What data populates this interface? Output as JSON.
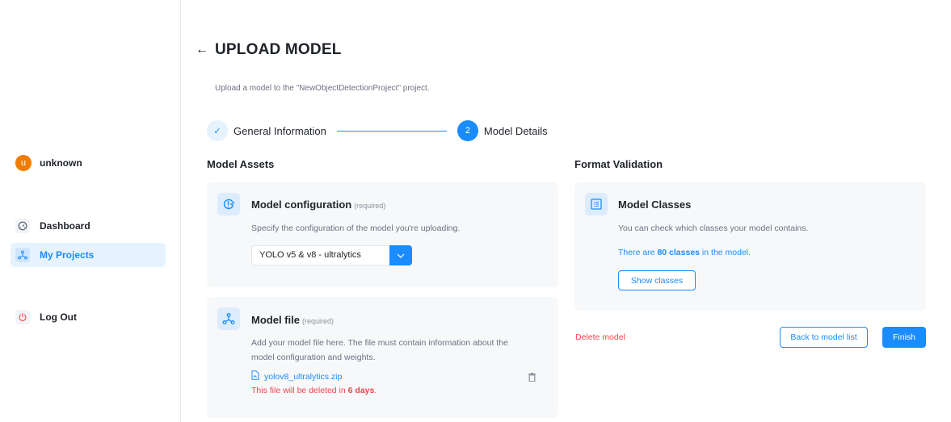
{
  "user": {
    "initial": "u",
    "name": "unknown",
    "avatar_color": "#f07c00"
  },
  "sidebar": {
    "items": [
      {
        "label": "Dashboard",
        "icon": "gauge-icon",
        "active": false
      },
      {
        "label": "My Projects",
        "icon": "network-icon",
        "active": true
      },
      {
        "label": "Log Out",
        "icon": "power-icon",
        "active": false
      }
    ]
  },
  "header": {
    "back_icon": "←",
    "title": "UPLOAD MODEL",
    "subtitle": "Upload a model to the \"NewObjectDetectionProject\" project."
  },
  "stepper": {
    "steps": [
      {
        "label": "General Information",
        "marker": "✓",
        "state": "done"
      },
      {
        "label": "Model Details",
        "marker": "2",
        "state": "current"
      }
    ]
  },
  "assets": {
    "section_title": "Model Assets",
    "config": {
      "title": "Model configuration",
      "required": "(required)",
      "description": "Specify the configuration of the model you're uploading.",
      "selected": "YOLO v5 & v8 - ultralytics"
    },
    "file": {
      "title": "Model file",
      "required": "(required)",
      "description": "Add your model file here. The file must contain information about the model configuration and weights.",
      "filename": "yolov8_ultralytics.zip",
      "warning_prefix": "This file will be deleted in ",
      "warning_days": "6 days",
      "warning_suffix": "."
    }
  },
  "validation": {
    "section_title": "Format Validation",
    "classes": {
      "title": "Model Classes",
      "description": "You can check which classes your model contains.",
      "info_prefix": "There are ",
      "info_count": "80 classes",
      "info_suffix": " in the model.",
      "button": "Show classes"
    }
  },
  "actions": {
    "delete": "Delete model",
    "back": "Back to model list",
    "finish": "Finish"
  },
  "colors": {
    "accent": "#1a8cff",
    "danger": "#f0454b",
    "card_bg": "#f7f8fa"
  }
}
